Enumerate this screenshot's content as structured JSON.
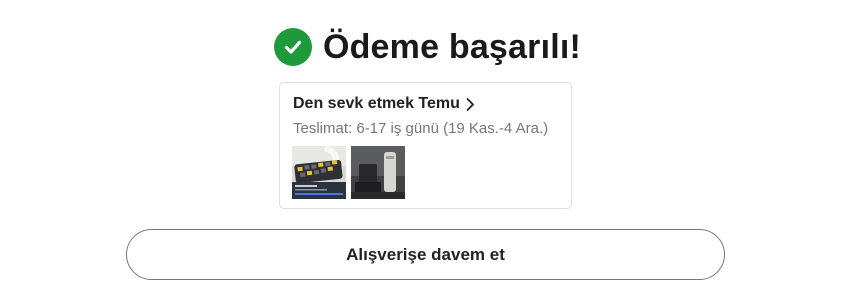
{
  "header": {
    "title": "Ödeme başarılı!",
    "icon": "check-circle-icon",
    "accent_color": "#1f9a3a"
  },
  "order_card": {
    "seller": "Den sevk etmek Temu",
    "seller_icon": "chevron-right-icon",
    "delivery": "Teslimat: 6-17 iş günü (19 Kas.-4 Ara.)",
    "products": [
      {
        "name": "keyboard-product-image"
      },
      {
        "name": "gray-device-product-image"
      }
    ]
  },
  "footer": {
    "continue_label": "Alışverişe davem et"
  }
}
